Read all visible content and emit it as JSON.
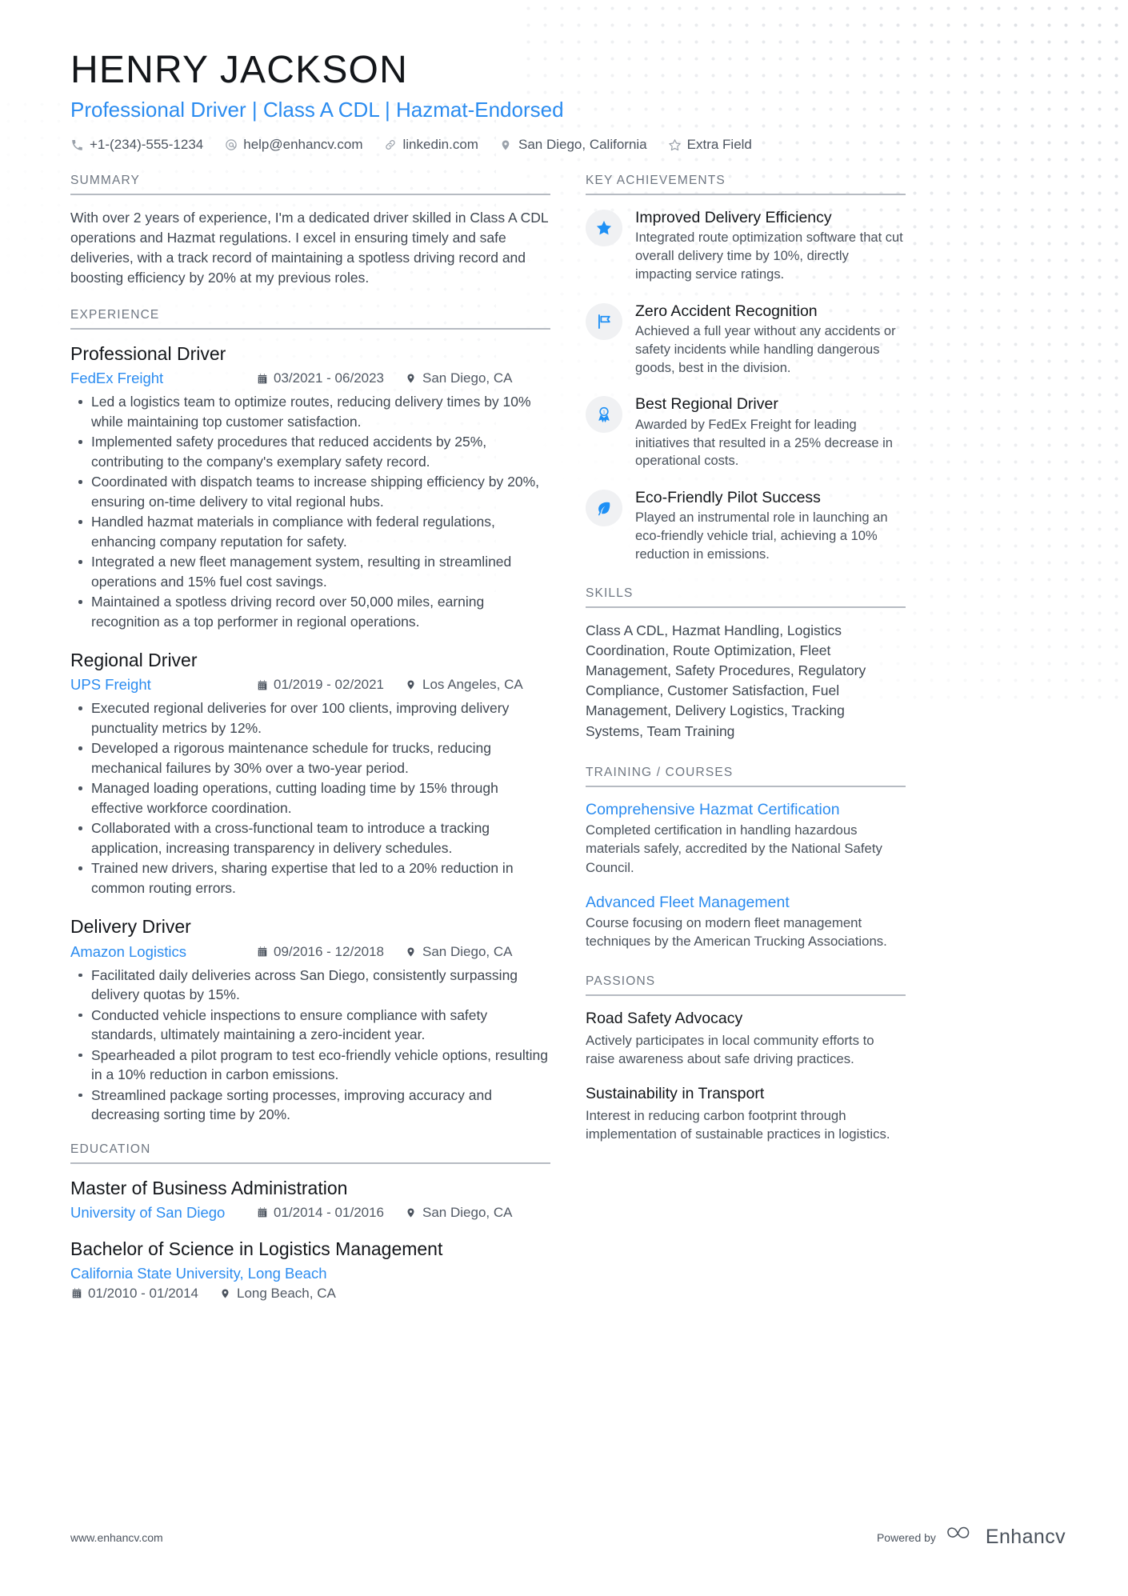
{
  "header": {
    "name": "HENRY JACKSON",
    "headline": "Professional Driver | Class A CDL | Hazmat-Endorsed",
    "contacts": [
      {
        "icon": "phone-icon",
        "text": "+1-(234)-555-1234"
      },
      {
        "icon": "email-icon",
        "text": "help@enhancv.com"
      },
      {
        "icon": "link-icon",
        "text": "linkedin.com"
      },
      {
        "icon": "location-icon",
        "text": "San Diego, California"
      },
      {
        "icon": "star-icon",
        "text": "Extra Field"
      }
    ]
  },
  "summary": {
    "title": "SUMMARY",
    "text": "With over 2 years of experience, I'm a dedicated driver skilled in Class A CDL operations and Hazmat regulations. I excel in ensuring timely and safe deliveries, with a track record of maintaining a spotless driving record and boosting efficiency by 20% at my previous roles."
  },
  "experience": {
    "title": "EXPERIENCE",
    "entries": [
      {
        "role": "Professional Driver",
        "company": "FedEx Freight",
        "dates": "03/2021 - 06/2023",
        "location": "San Diego, CA",
        "bullets": [
          "Led a logistics team to optimize routes, reducing delivery times by 10% while maintaining top customer satisfaction.",
          "Implemented safety procedures that reduced accidents by 25%, contributing to the company's exemplary safety record.",
          "Coordinated with dispatch teams to increase shipping efficiency by 20%, ensuring on-time delivery to vital regional hubs.",
          "Handled hazmat materials in compliance with federal regulations, enhancing company reputation for safety.",
          "Integrated a new fleet management system, resulting in streamlined operations and 15% fuel cost savings.",
          "Maintained a spotless driving record over 50,000 miles, earning recognition as a top performer in regional operations."
        ]
      },
      {
        "role": "Regional Driver",
        "company": "UPS Freight",
        "dates": "01/2019 - 02/2021",
        "location": "Los Angeles, CA",
        "bullets": [
          "Executed regional deliveries for over 100 clients, improving delivery punctuality metrics by 12%.",
          "Developed a rigorous maintenance schedule for trucks, reducing mechanical failures by 30% over a two-year period.",
          "Managed loading operations, cutting loading time by 15% through effective workforce coordination.",
          "Collaborated with a cross-functional team to introduce a tracking application, increasing transparency in delivery schedules.",
          "Trained new drivers, sharing expertise that led to a 20% reduction in common routing errors."
        ]
      },
      {
        "role": "Delivery Driver",
        "company": "Amazon Logistics",
        "dates": "09/2016 - 12/2018",
        "location": "San Diego, CA",
        "bullets": [
          "Facilitated daily deliveries across San Diego, consistently surpassing delivery quotas by 15%.",
          "Conducted vehicle inspections to ensure compliance with safety standards, ultimately maintaining a zero-incident year.",
          "Spearheaded a pilot program to test eco-friendly vehicle options, resulting in a 10% reduction in carbon emissions.",
          "Streamlined package sorting processes, improving accuracy and decreasing sorting time by 20%."
        ]
      }
    ]
  },
  "education": {
    "title": "EDUCATION",
    "entries": [
      {
        "degree": "Master of Business Administration",
        "school": "University of San Diego",
        "dates": "01/2014 - 01/2016",
        "location": "San Diego, CA",
        "stacked": false
      },
      {
        "degree": "Bachelor of Science in Logistics Management",
        "school": "California State University, Long Beach",
        "dates": "01/2010 - 01/2014",
        "location": "Long Beach, CA",
        "stacked": true
      }
    ]
  },
  "achievements": {
    "title": "KEY ACHIEVEMENTS",
    "items": [
      {
        "icon": "star-badge-icon",
        "title": "Improved Delivery Efficiency",
        "desc": "Integrated route optimization software that cut overall delivery time by 10%, directly impacting service ratings."
      },
      {
        "icon": "flag-badge-icon",
        "title": "Zero Accident Recognition",
        "desc": "Achieved a full year without any accidents or safety incidents while handling dangerous goods, best in the division."
      },
      {
        "icon": "award-badge-icon",
        "title": "Best Regional Driver",
        "desc": "Awarded by FedEx Freight for leading initiatives that resulted in a 25% decrease in operational costs."
      },
      {
        "icon": "leaf-badge-icon",
        "title": "Eco-Friendly Pilot Success",
        "desc": "Played an instrumental role in launching an eco-friendly vehicle trial, achieving a 10% reduction in emissions."
      }
    ]
  },
  "skills": {
    "title": "SKILLS",
    "text": "Class A CDL, Hazmat Handling, Logistics Coordination, Route Optimization, Fleet Management, Safety Procedures, Regulatory Compliance, Customer Satisfaction, Fuel Management, Delivery Logistics, Tracking Systems, Team Training"
  },
  "training": {
    "title": "TRAINING / COURSES",
    "items": [
      {
        "name": "Comprehensive Hazmat Certification",
        "desc": "Completed certification in handling hazardous materials safely, accredited by the National Safety Council."
      },
      {
        "name": "Advanced Fleet Management",
        "desc": "Course focusing on modern fleet management techniques by the American Trucking Associations."
      }
    ]
  },
  "passions": {
    "title": "PASSIONS",
    "items": [
      {
        "name": "Road Safety Advocacy",
        "desc": "Actively participates in local community efforts to raise awareness about safe driving practices."
      },
      {
        "name": "Sustainability in Transport",
        "desc": "Interest in reducing carbon footprint through implementation of sustainable practices in logistics."
      }
    ]
  },
  "footer": {
    "url": "www.enhancv.com",
    "powered_by": "Powered by",
    "brand": "Enhancv"
  },
  "colors": {
    "accent": "#2b8cf0",
    "heading": "#13161a",
    "muted": "#6f7782",
    "text": "#3f4751",
    "badge_bg": "#f0f1f3"
  }
}
